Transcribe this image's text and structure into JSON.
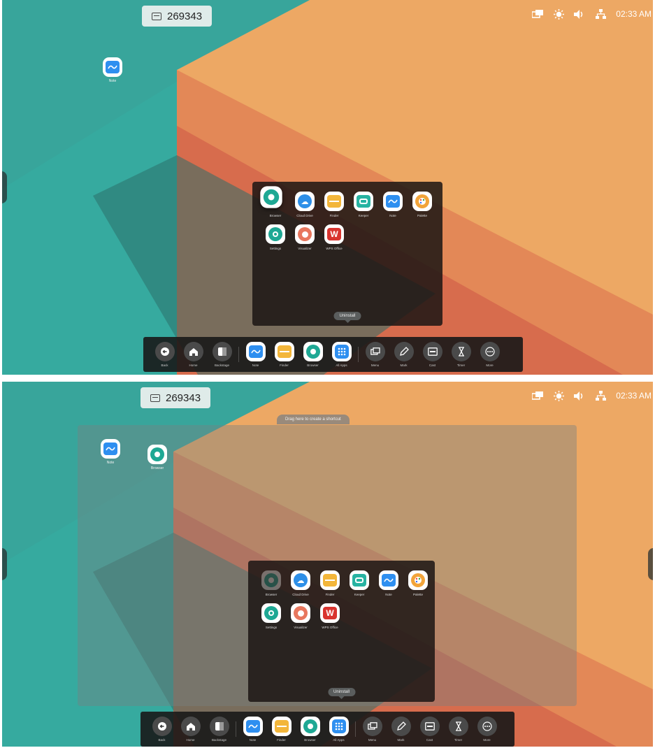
{
  "screens": [
    {
      "room_code": "269343",
      "status": {
        "time": "02:33 AM",
        "icons": [
          "screen-share-icon",
          "brightness-icon",
          "volume-icon",
          "network-icon"
        ]
      },
      "desktop_icons": [
        {
          "label": "Note",
          "icon": "note-icon"
        }
      ],
      "drag_hint": "",
      "app_panel": {
        "apps": [
          {
            "label": "Browser",
            "icon": "browser-icon"
          },
          {
            "label": "Cloud Drive",
            "icon": "cloud-drive-icon"
          },
          {
            "label": "Finder",
            "icon": "finder-icon"
          },
          {
            "label": "Keeper",
            "icon": "keeper-icon"
          },
          {
            "label": "Note",
            "icon": "note-icon"
          },
          {
            "label": "Palette",
            "icon": "palette-icon"
          },
          {
            "label": "Settings",
            "icon": "settings-icon"
          },
          {
            "label": "Visualizer",
            "icon": "visualizer-icon"
          },
          {
            "label": "WPS Office",
            "icon": "wps-office-icon"
          }
        ],
        "uninstall_label": "Uninstall"
      }
    },
    {
      "room_code": "269343",
      "status": {
        "time": "02:33 AM",
        "icons": [
          "screen-share-icon",
          "brightness-icon",
          "volume-icon",
          "network-icon"
        ]
      },
      "desktop_icons": [
        {
          "label": "Note",
          "icon": "note-icon"
        },
        {
          "label": "Browser",
          "icon": "browser-icon"
        }
      ],
      "drag_hint": "Drag here to create a shortcut",
      "app_panel": {
        "apps": [
          {
            "label": "Browser",
            "icon": "browser-icon"
          },
          {
            "label": "Cloud Drive",
            "icon": "cloud-drive-icon"
          },
          {
            "label": "Finder",
            "icon": "finder-icon"
          },
          {
            "label": "Keeper",
            "icon": "keeper-icon"
          },
          {
            "label": "Note",
            "icon": "note-icon"
          },
          {
            "label": "Palette",
            "icon": "palette-icon"
          },
          {
            "label": "Settings",
            "icon": "settings-icon"
          },
          {
            "label": "Visualizer",
            "icon": "visualizer-icon"
          },
          {
            "label": "WPS Office",
            "icon": "wps-office-icon"
          }
        ],
        "uninstall_label": "Uninstall"
      }
    }
  ],
  "dock": [
    {
      "label": "Back",
      "icon": "back-icon"
    },
    {
      "label": "Home",
      "icon": "home-icon"
    },
    {
      "label": "Backstage",
      "icon": "backstage-icon"
    },
    {
      "label": "Note",
      "icon": "note-icon"
    },
    {
      "label": "Finder",
      "icon": "finder-icon"
    },
    {
      "label": "Browser",
      "icon": "browser-icon"
    },
    {
      "label": "All Apps",
      "icon": "all-apps-icon"
    },
    {
      "label": "Menu",
      "icon": "menu-icon"
    },
    {
      "label": "Mark",
      "icon": "mark-icon"
    },
    {
      "label": "Cast",
      "icon": "cast-icon"
    },
    {
      "label": "Timer",
      "icon": "timer-icon"
    },
    {
      "label": "More",
      "icon": "more-icon"
    }
  ],
  "colors": {
    "teal": "#38b2a3",
    "orange": "#eeaa62",
    "deep_orange": "#d96a4c",
    "note_blue": "#2e8ff0",
    "browser_teal": "#1ea894",
    "finder_yellow": "#f3b63a",
    "wps_red": "#d9342f"
  }
}
